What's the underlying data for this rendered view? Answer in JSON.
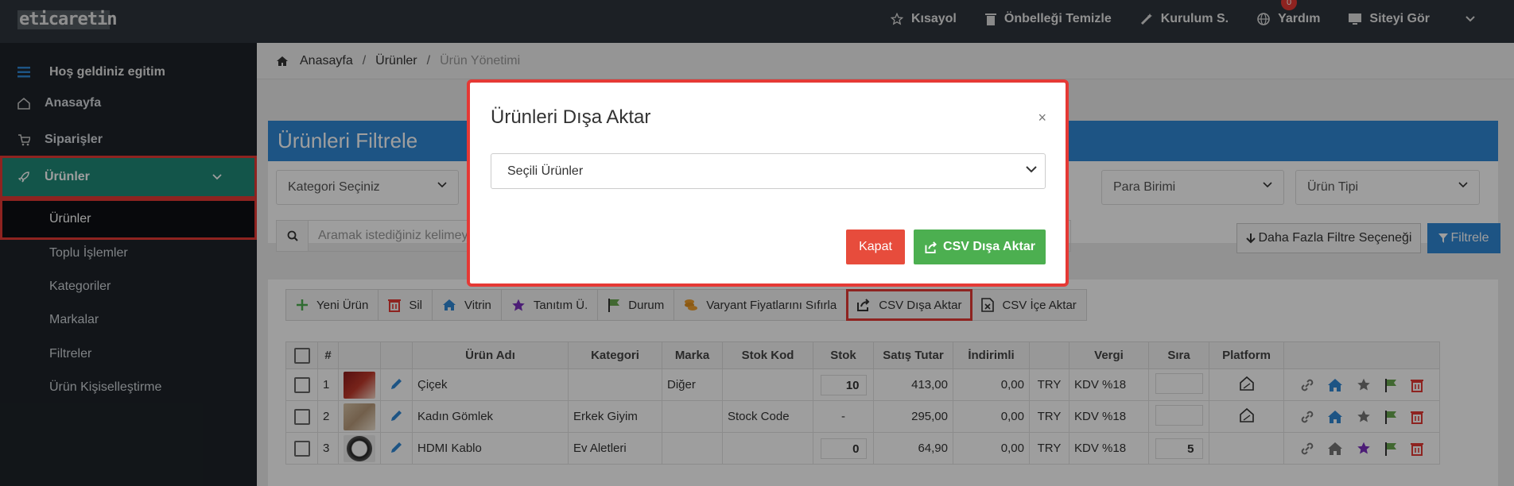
{
  "header": {
    "logo_text": "eticaretin",
    "nav": [
      {
        "label": "Kısayol",
        "icon": "star-icon"
      },
      {
        "label": "Önbelleği Temizle",
        "icon": "trash-icon"
      },
      {
        "label": "Kurulum S.",
        "icon": "magic-wand-icon"
      },
      {
        "label": "Yardım",
        "icon": "globe-icon",
        "badge": "0"
      },
      {
        "label": "Siteyi Gör",
        "icon": "monitor-icon"
      }
    ]
  },
  "sidebar": {
    "welcome": "Hoş geldiniz egitim",
    "items": [
      {
        "label": "Anasayfa",
        "icon": "home-icon"
      },
      {
        "label": "Siparişler",
        "icon": "cart-icon"
      },
      {
        "label": "Ürünler",
        "icon": "rocket-icon",
        "active": true
      }
    ],
    "sub_items": [
      {
        "label": "Ürünler",
        "active": true
      },
      {
        "label": "Toplu İşlemler"
      },
      {
        "label": "Kategoriler"
      },
      {
        "label": "Markalar"
      },
      {
        "label": "Filtreler"
      },
      {
        "label": "Ürün Kişiselleştirme"
      }
    ]
  },
  "breadcrumb": {
    "home": "Anasayfa",
    "section": "Ürünler",
    "current": "Ürün Yönetimi"
  },
  "filter": {
    "title": "Ürünleri Filtrele",
    "category_placeholder": "Kategori Seçiniz",
    "currency_placeholder": "Para Birimi",
    "type_placeholder": "Ürün Tipi",
    "search_placeholder": "Aramak istediğiniz kelimey",
    "more_filters": "Daha Fazla Filtre Seçeneği",
    "filter_button": "Filtrele"
  },
  "toolbar": [
    {
      "label": "Yeni Ürün",
      "icon": "plus-icon"
    },
    {
      "label": "Sil",
      "icon": "trash-icon"
    },
    {
      "label": "Vitrin",
      "icon": "home-icon"
    },
    {
      "label": "Tanıtım Ü.",
      "icon": "star-icon"
    },
    {
      "label": "Durum",
      "icon": "flag-icon"
    },
    {
      "label": "Varyant Fiyatlarını Sıfırla",
      "icon": "coins-icon"
    },
    {
      "label": "CSV Dışa Aktar",
      "icon": "export-icon",
      "highlighted": true
    },
    {
      "label": "CSV İçe Aktar",
      "icon": "excel-icon"
    }
  ],
  "table": {
    "headers": [
      "#",
      "Ürün Adı",
      "Kategori",
      "Marka",
      "Stok Kod",
      "Stok",
      "Satış Tutar",
      "İndirimli",
      "Vergi",
      "Sıra",
      "Platform"
    ],
    "rows": [
      {
        "no": "1",
        "name": "Çiçek",
        "category": "",
        "brand": "Diğer",
        "stock_code": "",
        "stock": "10",
        "price": "413,00",
        "discounted": "0,00",
        "currency": "TRY",
        "tax": "KDV %18",
        "order": ""
      },
      {
        "no": "2",
        "name": "Kadın Gömlek",
        "category": "Erkek Giyim",
        "brand": "",
        "stock_code": "Stock Code",
        "stock": "-",
        "price": "295,00",
        "discounted": "0,00",
        "currency": "TRY",
        "tax": "KDV %18",
        "order": ""
      },
      {
        "no": "3",
        "name": "HDMI Kablo",
        "category": "Ev Aletleri",
        "brand": "",
        "stock_code": "",
        "stock": "0",
        "price": "64,90",
        "discounted": "0,00",
        "currency": "TRY",
        "tax": "KDV %18",
        "order": "5"
      }
    ]
  },
  "modal": {
    "title": "Ürünleri Dışa Aktar",
    "close": "×",
    "select_value": "Seçili Ürünler",
    "cancel": "Kapat",
    "confirm": "CSV Dışa Aktar"
  },
  "colors": {
    "accent_blue": "#2f88d6",
    "sidebar_active": "#1f8a78",
    "highlight_red": "#e53935",
    "success": "#4caf50"
  }
}
